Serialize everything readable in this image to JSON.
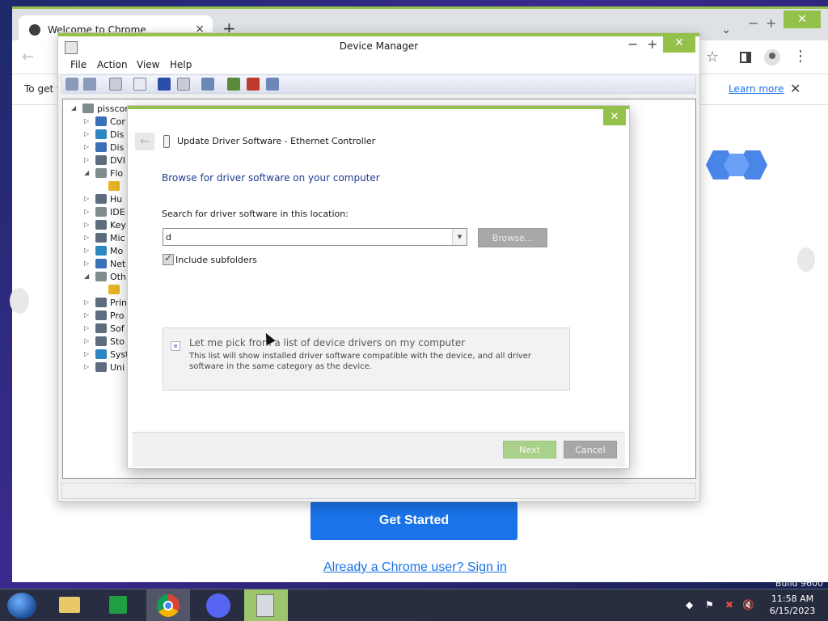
{
  "chrome": {
    "tab_title": "Welcome to Chrome",
    "close_tab": "×",
    "new_tab": "+",
    "min": "−",
    "max": "+",
    "close": "✕",
    "chevron": "⌄",
    "back": "←",
    "forward": "→",
    "star": "☆",
    "menu": "⋮",
    "infobar_text": "To get f",
    "learn_more": "Learn more",
    "infobar_close": "✕",
    "get_started": "Get Started",
    "signin": "Already a Chrome user? Sign in",
    "build": "Build 9600"
  },
  "device_manager": {
    "title": "Device Manager",
    "min": "−",
    "max": "+",
    "close": "✕",
    "menu": [
      "File",
      "Action",
      "View",
      "Help"
    ],
    "tree": [
      {
        "label": "pisscord",
        "arrow": "◢",
        "level": 0
      },
      {
        "label": "Cor",
        "arrow": "▷",
        "level": 1
      },
      {
        "label": "Dis",
        "arrow": "▷",
        "level": 1
      },
      {
        "label": "Dis",
        "arrow": "▷",
        "level": 1
      },
      {
        "label": "DVI",
        "arrow": "▷",
        "level": 1
      },
      {
        "label": "Flo",
        "arrow": "◢",
        "level": 1
      },
      {
        "label": "",
        "arrow": "",
        "level": 2
      },
      {
        "label": "Hu",
        "arrow": "▷",
        "level": 1
      },
      {
        "label": "IDE",
        "arrow": "▷",
        "level": 1
      },
      {
        "label": "Key",
        "arrow": "▷",
        "level": 1
      },
      {
        "label": "Mic",
        "arrow": "▷",
        "level": 1
      },
      {
        "label": "Mo",
        "arrow": "▷",
        "level": 1
      },
      {
        "label": "Net",
        "arrow": "▷",
        "level": 1
      },
      {
        "label": "Oth",
        "arrow": "◢",
        "level": 1
      },
      {
        "label": "",
        "arrow": "",
        "level": 2
      },
      {
        "label": "Prin",
        "arrow": "▷",
        "level": 1
      },
      {
        "label": "Pro",
        "arrow": "▷",
        "level": 1
      },
      {
        "label": "Sof",
        "arrow": "▷",
        "level": 1
      },
      {
        "label": "Sto",
        "arrow": "▷",
        "level": 1
      },
      {
        "label": "Syst",
        "arrow": "▷",
        "level": 1
      },
      {
        "label": "Uni",
        "arrow": "▷",
        "level": 1
      }
    ]
  },
  "update_dialog": {
    "close": "✕",
    "back": "←",
    "title": "Update Driver Software - Ethernet Controller",
    "heading": "Browse for driver software on your computer",
    "search_label": "Search for driver software in this location:",
    "path_value": "d",
    "dropdown_arrow": "▼",
    "browse": "Browse...",
    "include_subfolders": "Include subfolders",
    "pick_title": "Let me pick from a list of device drivers on my computer",
    "pick_desc": "This list will show installed driver software compatible with the device, and all driver software in the same category as the device.",
    "next": "Next",
    "cancel": "Cancel"
  },
  "taskbar": {
    "tray_arrow": "◆",
    "flag": "⚑",
    "network": "✖",
    "volume": "🔇",
    "time": "11:58 AM",
    "date": "6/15/2023"
  },
  "colors": {
    "accent_green": "#94c14a",
    "chrome_blue": "#1a73e8",
    "dialog_heading": "#1e3d8f"
  }
}
